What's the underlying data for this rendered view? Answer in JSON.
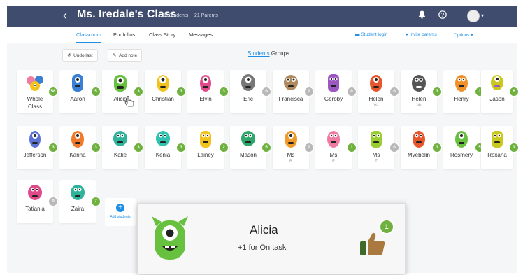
{
  "header": {
    "back_icon": "chevron-left-icon",
    "class_name": "Ms. Iredale's Class",
    "students_count": "25 Students",
    "parents_count": "21 Parents",
    "icons": [
      "bell-icon",
      "help-icon",
      "user-avatar"
    ]
  },
  "nav": {
    "tabs": [
      "Classroom",
      "Portfolios",
      "Class Story",
      "Messages"
    ],
    "active_tab": "Classroom",
    "student_login": "Student login",
    "invite_parents": "Invite parents",
    "options": "Options"
  },
  "toolbar": {
    "undo_label": "Undo last",
    "add_note_label": "Add note",
    "toggle_students": "Students",
    "toggle_groups": "Groups"
  },
  "students": [
    {
      "name": "Whole",
      "name2": "Class",
      "points": "58",
      "color": "#f07aa0"
    },
    {
      "name": "Aaron",
      "points": "5",
      "color": "#3a7fd6"
    },
    {
      "name": "Alicia",
      "points": "3",
      "color": "#67c03e"
    },
    {
      "name": "Christian",
      "points": "3",
      "color": "#f2c21d"
    },
    {
      "name": "Elvin",
      "points": "3",
      "color": "#e0498a"
    },
    {
      "name": "Eric",
      "points": "0",
      "color": "#777777"
    },
    {
      "name": "Francisca",
      "points": "0",
      "color": "#b08a5e"
    },
    {
      "name": "Geroby",
      "points": "0",
      "color": "#9b58c2"
    },
    {
      "name": "Helen",
      "name2": "Va",
      "points": "0",
      "color": "#e8562e"
    },
    {
      "name": "Helen",
      "name2": "Ve",
      "points": "3",
      "color": "#555555"
    },
    {
      "name": "Henry",
      "points": "1",
      "color": "#f0902a"
    },
    {
      "name": "Jason",
      "points": "6",
      "color": "#c8c81e"
    },
    {
      "name": "Jefferson",
      "points": "3",
      "color": "#5c72d6"
    },
    {
      "name": "Karina",
      "points": "3",
      "color": "#f07a2a"
    },
    {
      "name": "Katie",
      "points": "3",
      "color": "#2fb39a"
    },
    {
      "name": "Kenia",
      "points": "3",
      "color": "#2fc2b0"
    },
    {
      "name": "Lainey",
      "points": "2",
      "color": "#f2c21d"
    },
    {
      "name": "Mason",
      "points": "5",
      "color": "#2fa66a"
    },
    {
      "name": "Ms",
      "name2": "B",
      "points": "0",
      "color": "#f09a2a"
    },
    {
      "name": "Ms",
      "name2": "F",
      "points": "1",
      "color": "#f07aa0"
    },
    {
      "name": "Ms",
      "name2": "T",
      "points": "0",
      "color": "#9acd32"
    },
    {
      "name": "Myebelin",
      "points": "1",
      "color": "#e8562e"
    },
    {
      "name": "Rosmery",
      "points": "5",
      "color": "#67c03e"
    },
    {
      "name": "Roxana",
      "points": "1",
      "color": "#c8c81e"
    },
    {
      "name": "Tatiania",
      "points": "0",
      "color": "#e0498a"
    },
    {
      "name": "Zaira",
      "points": "7",
      "color": "#2fb39a"
    }
  ],
  "add_students_label": "Add students",
  "popup": {
    "student_name": "Alicia",
    "feedback": "+1 for On task",
    "points": "1",
    "monster_color": "#67c03e",
    "icon": "thumbs-up-icon"
  }
}
